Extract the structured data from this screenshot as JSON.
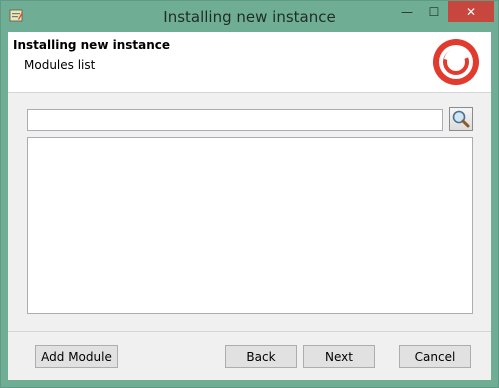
{
  "window": {
    "title": "Installing new instance"
  },
  "titlebar_buttons": {
    "minimize": "—",
    "maximize": "☐",
    "close": "✕"
  },
  "header": {
    "title": "Installing new instance",
    "subtitle": "Modules list"
  },
  "search": {
    "value": "",
    "placeholder": ""
  },
  "module_list": {
    "items": []
  },
  "buttons": {
    "add_module": "Add Module",
    "back": "Back",
    "next": "Next",
    "cancel": "Cancel"
  },
  "colors": {
    "titlebar": "#6fae95",
    "close_button": "#c7463d",
    "logo_red": "#e03b2e"
  },
  "icons": {
    "app": "app-icon",
    "search": "magnifier-icon",
    "logo": "sitecore-logo"
  }
}
